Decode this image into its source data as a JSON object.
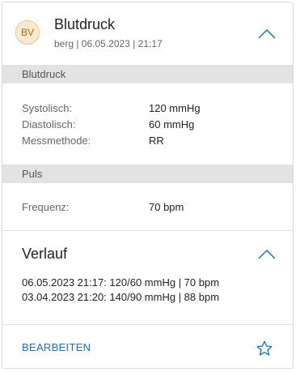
{
  "header": {
    "avatar_initials": "BV",
    "title": "Blutdruck",
    "subtitle": "berg | 06.05.2023 | 21:17",
    "collapse_icon": "chevron-up-icon"
  },
  "blutdruck_section": {
    "label": "Blutdruck",
    "rows": [
      {
        "label": "Systolisch:",
        "value": "120 mmHg"
      },
      {
        "label": "Diastolisch:",
        "value": "60 mmHg"
      },
      {
        "label": "Messmethode:",
        "value": "RR"
      }
    ]
  },
  "puls_section": {
    "label": "Puls",
    "rows": [
      {
        "label": "Frequenz:",
        "value": "70 bpm"
      }
    ]
  },
  "verlauf": {
    "title": "Verlauf",
    "entries": [
      "06.05.2023 21:17: 120/60 mmHg | 70 bpm",
      "03.04.2023 21:20: 140/90 mmHg | 88 bpm"
    ]
  },
  "footer": {
    "edit_label": "BEARBEITEN",
    "favorite_icon": "star-icon"
  },
  "colors": {
    "accent": "#1f6fb2",
    "section_bar": "#e3e3e3",
    "avatar_bg": "#fde9cf"
  }
}
